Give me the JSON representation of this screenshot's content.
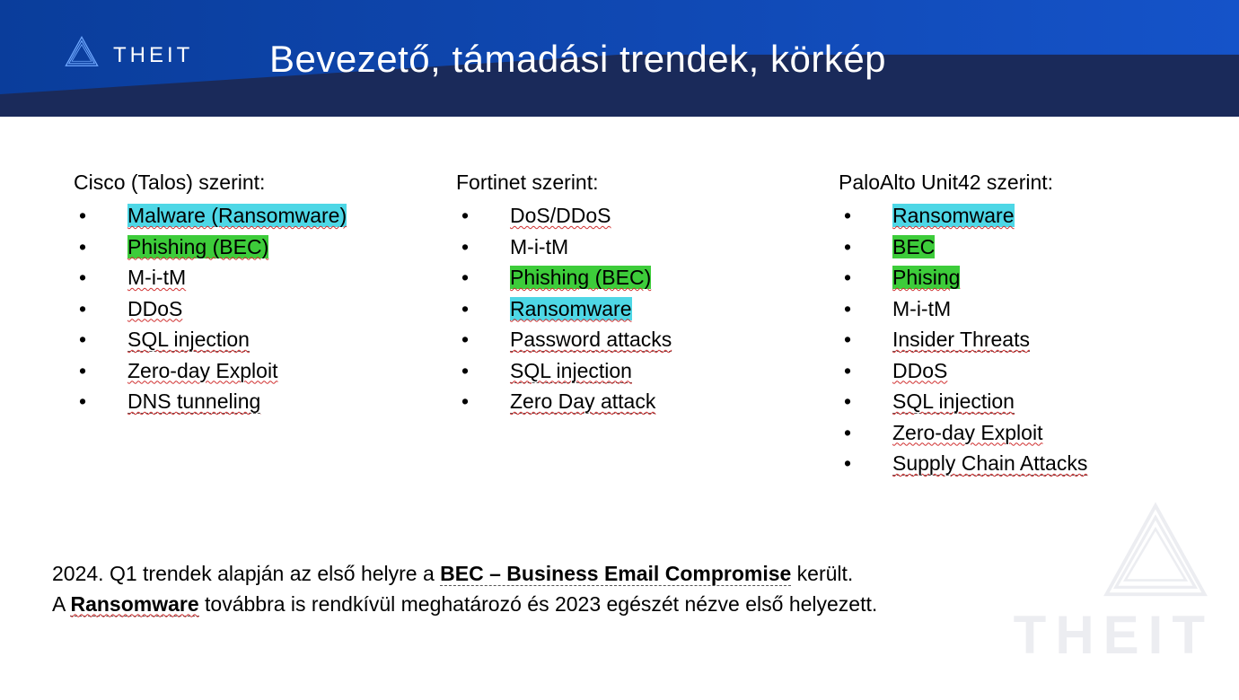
{
  "brand": {
    "name": "THEIT"
  },
  "title": "Bevezető, támadási trendek, körkép",
  "columns": [
    {
      "heading": "Cisco (Talos) szerint:",
      "items": [
        {
          "text": "Malware (Ransomware)",
          "hl": "cyan",
          "squig": true
        },
        {
          "text": "Phishing (BEC)",
          "hl": "green",
          "squig": true
        },
        {
          "text": "M-i-tM",
          "squig": true
        },
        {
          "text": "DDoS",
          "squig": true
        },
        {
          "text": "SQL injection",
          "squig": true,
          "dash": true
        },
        {
          "text": "Zero-day Exploit",
          "squig": true
        },
        {
          "text": "DNS tunneling",
          "squig": true,
          "dash": true
        }
      ]
    },
    {
      "heading": "Fortinet szerint:",
      "items": [
        {
          "text": "DoS/DDoS",
          "squig": true
        },
        {
          "text": "M-i-tM"
        },
        {
          "text": "Phishing (BEC)",
          "hl": "green",
          "squig": true
        },
        {
          "text": "Ransomware",
          "hl": "cyan",
          "squig": true
        },
        {
          "text": "Password attacks",
          "squig": true,
          "dash": true
        },
        {
          "text": "SQL injection",
          "squig": true,
          "dash": true
        },
        {
          "text": "Zero Day attack",
          "squig": true,
          "dash": true
        }
      ]
    },
    {
      "heading": "PaloAlto Unit42 szerint:",
      "items": [
        {
          "text": "Ransomware",
          "hl": "cyan",
          "squig": true
        },
        {
          "text": "BEC",
          "hl": "green"
        },
        {
          "text": "Phising",
          "hl": "green",
          "squig": true
        },
        {
          "text": "M-i-tM"
        },
        {
          "text": "Insider Threats",
          "squig": true,
          "dash": true
        },
        {
          "text": "DDoS",
          "squig": true
        },
        {
          "text": "SQL injection",
          "squig": true,
          "dash": true
        },
        {
          "text": "Zero-day Exploit",
          "squig": true
        },
        {
          "text": "Supply Chain Attacks",
          "squig": true,
          "dash": true
        }
      ]
    }
  ],
  "footer": {
    "line1_pre": "2024. Q1 trendek alapján az első helyre a ",
    "line1_bold": "BEC – Business Email Compromise",
    "line1_post": " került.",
    "line2_pre": "A ",
    "line2_bold": "Ransomware",
    "line2_post": " továbbra is rendkívül meghatározó és 2023 egészét nézve első helyezett."
  },
  "watermark": "THEIT"
}
